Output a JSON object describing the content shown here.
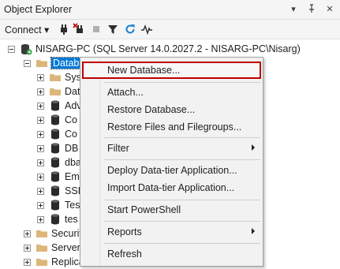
{
  "panel": {
    "title": "Object Explorer",
    "pin_symbol": "▾",
    "pin2_symbol": "⊥",
    "close_symbol": "✕"
  },
  "toolbar": {
    "connect_label": "Connect ▾"
  },
  "tree": {
    "server": "NISARG-PC (SQL Server 14.0.2027.2 - NISARG-PC\\Nisarg)",
    "databases": "Database",
    "children": [
      "Sys",
      "Dat",
      "Adv",
      "Co",
      "Co",
      "DB",
      "dba",
      "Em",
      "SSI",
      "Tes",
      "tes"
    ],
    "security": "Securit",
    "server_objects": "Server",
    "replication": "Replica"
  },
  "context_menu": {
    "items": [
      {
        "label": "New Database...",
        "submenu": false,
        "highlighted": true
      },
      {
        "label": "Attach...",
        "submenu": false
      },
      {
        "label": "Restore Database...",
        "submenu": false
      },
      {
        "label": "Restore Files and Filegroups...",
        "submenu": false
      },
      {
        "label": "Filter",
        "submenu": true
      },
      {
        "label": "Deploy Data-tier Application...",
        "submenu": false
      },
      {
        "label": "Import Data-tier Application...",
        "submenu": false
      },
      {
        "label": "Start PowerShell",
        "submenu": false
      },
      {
        "label": "Reports",
        "submenu": true
      },
      {
        "label": "Refresh",
        "submenu": false
      }
    ]
  },
  "colors": {
    "selection": "#0078d7",
    "highlight_border": "#c00000",
    "folder": "#dcb67a"
  }
}
